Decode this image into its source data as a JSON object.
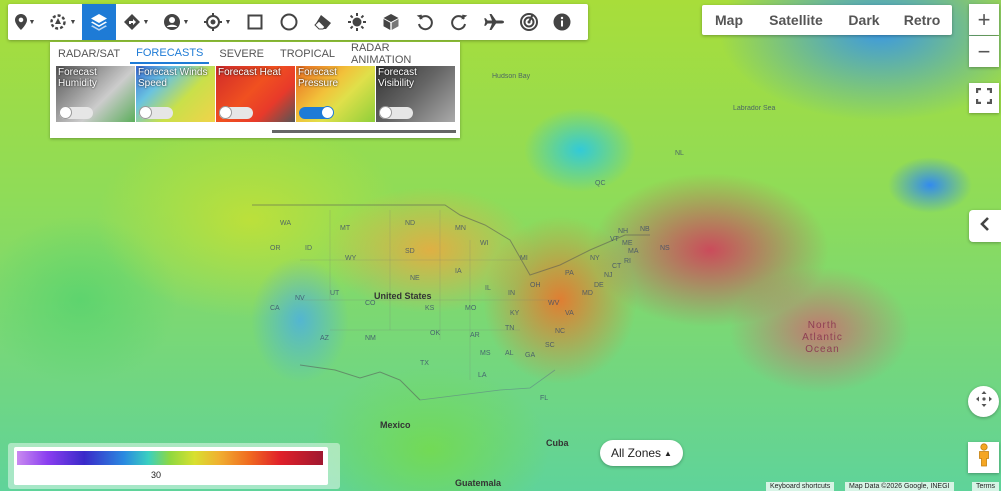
{
  "toolbar": {
    "buttons": [
      {
        "icon": "map-marker-icon",
        "dropdown": true
      },
      {
        "icon": "poi-settings-icon",
        "dropdown": true
      },
      {
        "icon": "layers-icon",
        "dropdown": false,
        "active": true
      },
      {
        "icon": "directions-icon",
        "dropdown": true
      },
      {
        "icon": "user-icon",
        "dropdown": true
      },
      {
        "icon": "location-target-icon",
        "dropdown": true
      },
      {
        "icon": "rectangle-icon",
        "dropdown": false
      },
      {
        "icon": "circle-icon",
        "dropdown": false
      },
      {
        "icon": "eraser-icon",
        "dropdown": false
      },
      {
        "icon": "brightness-icon",
        "dropdown": false
      },
      {
        "icon": "cube-icon",
        "dropdown": false
      },
      {
        "icon": "undo-icon",
        "dropdown": false
      },
      {
        "icon": "redo-icon",
        "dropdown": false
      },
      {
        "icon": "airplane-icon",
        "dropdown": false
      },
      {
        "icon": "radar-icon",
        "dropdown": false
      },
      {
        "icon": "info-icon",
        "dropdown": false
      }
    ],
    "accent": "#1e7bd6"
  },
  "layers_panel": {
    "tabs": [
      {
        "label": "RADAR/SAT",
        "active": false
      },
      {
        "label": "FORECASTS",
        "active": true
      },
      {
        "label": "SEVERE",
        "active": false
      },
      {
        "label": "TROPICAL",
        "active": false
      },
      {
        "label": "RADAR ANIMATION",
        "active": false
      }
    ],
    "cards": [
      {
        "title": "Forecast Humidity",
        "enabled": false
      },
      {
        "title": "Forecast Winds Speed",
        "enabled": false
      },
      {
        "title": "Forecast Heat",
        "enabled": false
      },
      {
        "title": "Forecast Pressure",
        "enabled": true
      },
      {
        "title": "Forecast Visibility",
        "enabled": false
      }
    ]
  },
  "map_types": [
    "Map",
    "Satellite",
    "Dark",
    "Retro"
  ],
  "zoom": {
    "in": "+",
    "out": "−"
  },
  "zones_button": {
    "label": "All Zones"
  },
  "legend": {
    "value": "30"
  },
  "map_labels": {
    "hudson_bay": "Hudson Bay",
    "labrador_sea": "Labrador Sea",
    "united_states": "United States",
    "mexico": "Mexico",
    "cuba": "Cuba",
    "guatemala": "Guatemala",
    "north_atlantic_ocean": "North Atlantic Ocean",
    "states": [
      "MT",
      "ND",
      "MN",
      "SD",
      "WI",
      "MI",
      "NE",
      "IA",
      "IL",
      "IN",
      "OH",
      "PA",
      "NY",
      "ME",
      "NS",
      "NB",
      "KS",
      "MO",
      "KY",
      "WV",
      "VA",
      "NC",
      "OK",
      "AR",
      "TN",
      "SC",
      "MS",
      "AL",
      "GA",
      "FL",
      "LA",
      "TX",
      "NM",
      "AZ",
      "CO",
      "UT",
      "NV",
      "CA",
      "OR",
      "WA",
      "ID",
      "WY",
      "QC",
      "NL",
      "MD",
      "DE",
      "NJ",
      "CT",
      "RI",
      "MA",
      "VT",
      "NH"
    ]
  },
  "attribution": {
    "shortcuts": "Keyboard shortcuts",
    "map_data": "Map Data ©2026 Google, INEGI",
    "terms": "Terms"
  }
}
